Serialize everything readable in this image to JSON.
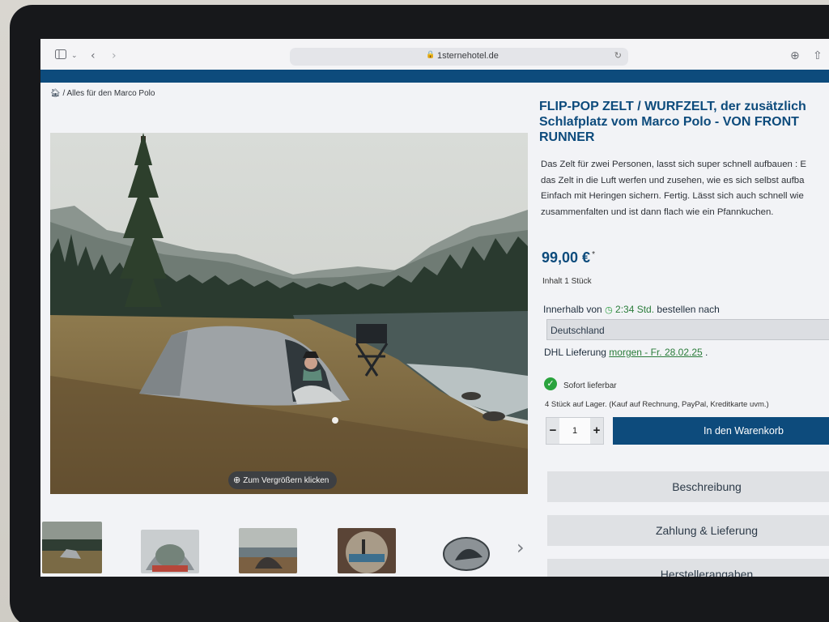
{
  "browser": {
    "url": "1sternehotel.de",
    "icons": [
      "sidebar-icon",
      "chevron-down-icon",
      "back-icon",
      "forward-icon",
      "lock-icon",
      "reload-icon",
      "download-icon",
      "share-icon"
    ]
  },
  "breadcrumb": {
    "label": "Alles für den Marco Polo"
  },
  "product": {
    "title_lines": [
      "FLIP-POP ZELT / WURFZELT, der zusätzlich",
      "Schlafplatz vom Marco Polo - VON FRONT",
      "RUNNER"
    ],
    "description_lines": [
      "Das Zelt für zwei Personen, lasst sich super schnell aufbauen : E",
      "das Zelt in die Luft werfen und zusehen, wie es sich selbst aufba",
      "Einfach mit Heringen sichern. Fertig. Lässt sich auch schnell wie",
      "zusammenfalten und ist dann flach wie ein Pfannkuchen."
    ],
    "price": "99,00 €",
    "price_asterisk": "*",
    "content": "Inhalt 1 Stück"
  },
  "gallery": {
    "zoom_label": "Zum Vergrößern klicken",
    "thumbnail_count": 5
  },
  "delivery": {
    "prefix": "Innerhalb von",
    "time": "2:34 Std.",
    "suffix": "bestellen nach",
    "country": "Deutschland",
    "dhl_prefix": "DHL Lieferung",
    "dhl_date": "morgen - Fr. 28.02.25",
    "dhl_suffix": "."
  },
  "stock": {
    "status": "Sofort lieferbar",
    "note": "4 Stück auf Lager. (Kauf auf Rechnung, PayPal, Kreditkarte uvm.)"
  },
  "buy": {
    "minus": "−",
    "quantity": "1",
    "plus": "+",
    "cart_label": "In den Warenkorb"
  },
  "tabs": [
    "Beschreibung",
    "Zahlung & Lieferung",
    "Herstellerangaben"
  ],
  "colors": {
    "brand": "#0d4b7c",
    "success": "#2aa33d"
  }
}
